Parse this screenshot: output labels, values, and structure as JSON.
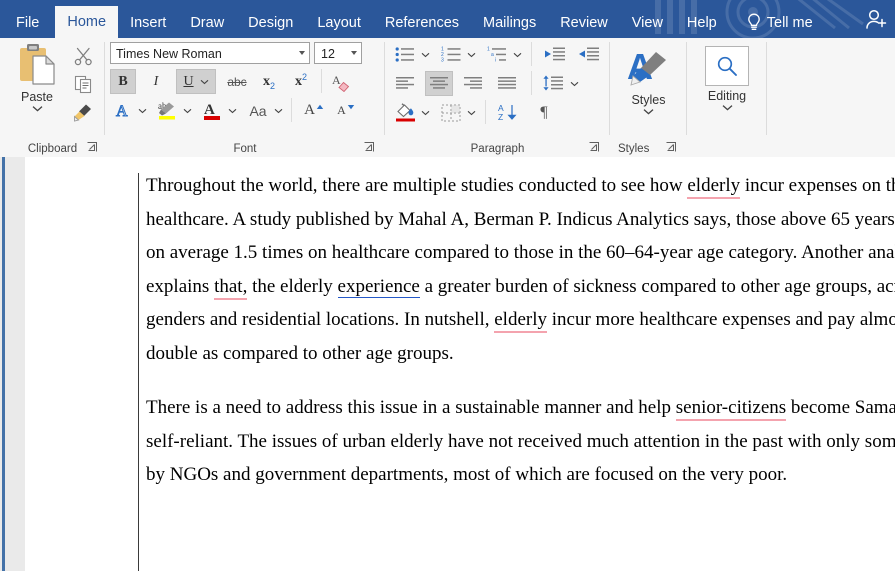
{
  "window": {
    "app": "Microsoft Word",
    "share_icon": "add-person-icon"
  },
  "tabs": [
    {
      "label": "File",
      "name": "tab-file",
      "active": false
    },
    {
      "label": "Home",
      "name": "tab-home",
      "active": true
    },
    {
      "label": "Insert",
      "name": "tab-insert",
      "active": false
    },
    {
      "label": "Draw",
      "name": "tab-draw",
      "active": false
    },
    {
      "label": "Design",
      "name": "tab-design",
      "active": false
    },
    {
      "label": "Layout",
      "name": "tab-layout",
      "active": false
    },
    {
      "label": "References",
      "name": "tab-references",
      "active": false
    },
    {
      "label": "Mailings",
      "name": "tab-mailings",
      "active": false
    },
    {
      "label": "Review",
      "name": "tab-review",
      "active": false
    },
    {
      "label": "View",
      "name": "tab-view",
      "active": false
    },
    {
      "label": "Help",
      "name": "tab-help",
      "active": false
    }
  ],
  "tellme": {
    "label": "Tell me",
    "icon": "lightbulb-icon"
  },
  "ribbon": {
    "groups": [
      {
        "label": "Clipboard",
        "name": "group-clipboard"
      },
      {
        "label": "Font",
        "name": "group-font"
      },
      {
        "label": "Paragraph",
        "name": "group-paragraph"
      },
      {
        "label": "Styles",
        "name": "group-styles"
      }
    ],
    "clipboard": {
      "paste_label": "Paste",
      "paste_icon": "clipboard-icon",
      "cut_icon": "scissors-icon",
      "copy_icon": "copy-icon",
      "format_painter_icon": "paintbrush-icon"
    },
    "font": {
      "font_name": "Times New Roman",
      "font_size": "12",
      "bold_label": "B",
      "bold_active": true,
      "italic_label": "I",
      "italic_active": false,
      "underline_label": "U",
      "underline_active": true,
      "strikethrough_label": "abc",
      "subscript_label": "x",
      "subscript_sub": "2",
      "superscript_label": "x",
      "superscript_sup": "2",
      "clear_formatting_icon": "clear-formatting-icon",
      "text_effects_icon": "text-effects-icon",
      "highlight_icon": "text-highlight-icon",
      "highlight_color": "#ffff00",
      "font_color_icon": "font-color-icon",
      "font_color": "#d80000",
      "change_case_label": "Aa",
      "grow_font_label": "A",
      "shrink_font_label": "A"
    },
    "paragraph": {
      "bullets_icon": "bullet-list-icon",
      "numbering_icon": "numbered-list-icon",
      "multilevel_icon": "multilevel-list-icon",
      "decrease_indent_icon": "decrease-indent-icon",
      "increase_indent_icon": "increase-indent-icon",
      "align_left_icon": "align-left-icon",
      "align_center_icon": "align-center-icon",
      "align_center_active": true,
      "align_right_icon": "align-right-icon",
      "justify_icon": "align-justify-icon",
      "line_spacing_icon": "line-spacing-icon",
      "shading_icon": "shading-icon",
      "borders_icon": "borders-icon",
      "sort_icon": "sort-az-icon",
      "show_marks_icon": "pilcrow-icon",
      "show_marks_label": "¶"
    },
    "styles": {
      "label": "Styles",
      "icon": "styles-brush-icon"
    },
    "editing": {
      "label": "Editing",
      "icon": "magnifier-icon"
    }
  },
  "document": {
    "paragraphs": [
      {
        "name": "paragraph-1",
        "runs": [
          {
            "t": "Throughout the world, there are multiple studies conducted to see how "
          },
          {
            "t": "elderly",
            "mark": "spelling"
          },
          {
            "t": " incur expenses on their healthcare. A study published by Mahal A, Berman P. Indicus Analytics says, those above 65 years spend on average 1.5 times on healthcare compared to those in the 60–64-year age category. Another analysis explains "
          },
          {
            "t": "that,",
            "mark": "spelling"
          },
          {
            "t": " the elderly "
          },
          {
            "t": "experience",
            "mark": "grammar"
          },
          {
            "t": " a greater burden of sickness compared to other age groups, across genders and residential locations. In nutshell, "
          },
          {
            "t": "elderly",
            "mark": "spelling"
          },
          {
            "t": " incur more healthcare expenses and pay almost double as compared to other age groups."
          }
        ]
      },
      {
        "name": "paragraph-2",
        "runs": [
          {
            "t": "There is a need to address this issue in a sustainable manner and help "
          },
          {
            "t": "senior-citizens",
            "mark": "spelling"
          },
          {
            "t": " become Samarth or self-reliant. The issues of urban elderly have not received much attention in the past with only some efforts by NGOs and government departments, most of which are focused on the very poor."
          }
        ]
      }
    ],
    "marks": {
      "spelling_color": "#f4a3ae",
      "grammar_color": "#2458c8"
    },
    "revision_bar": true
  },
  "colors": {
    "title_bar": "#2b579a",
    "ribbon_bg": "#f6f6f6",
    "accent": "#2b579a",
    "gutter": "#eaeaea"
  }
}
